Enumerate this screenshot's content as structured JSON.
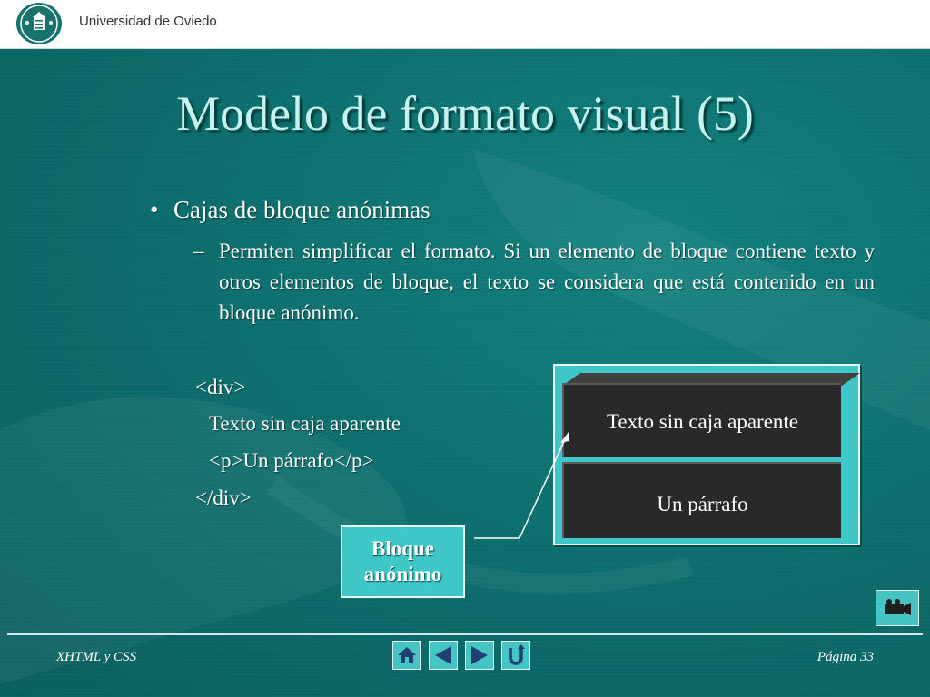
{
  "header": {
    "university": "Universidad de Oviedo"
  },
  "slide": {
    "title": "Modelo de formato visual (5)",
    "bullet": "Cajas de bloque anónimas",
    "sub_dash": "–",
    "sub_text": "Permiten simplificar el formato. Si un elemento de bloque contiene texto y otros elementos de bloque, el texto se considera que está contenido en un bloque anónimo.",
    "code": [
      "<div>",
      "Texto sin caja aparente",
      "<p>Un párrafo</p>",
      "</div>"
    ],
    "diagram": {
      "top_box": "Texto sin caja aparente",
      "bottom_box": "Un párrafo",
      "label_line1": "Bloque",
      "label_line2": "anónimo"
    }
  },
  "footer": {
    "left": "XHTML y CSS",
    "right": "Página 33"
  },
  "icons": {
    "logo": "university-crest-icon",
    "camera": "video-camera-icon",
    "nav": [
      "home-icon",
      "previous-icon",
      "next-icon",
      "return-icon"
    ]
  },
  "colors": {
    "background": "#0c6b6b",
    "title": "#c6f2ee",
    "accent": "#3fc7c7",
    "box": "#292929"
  }
}
